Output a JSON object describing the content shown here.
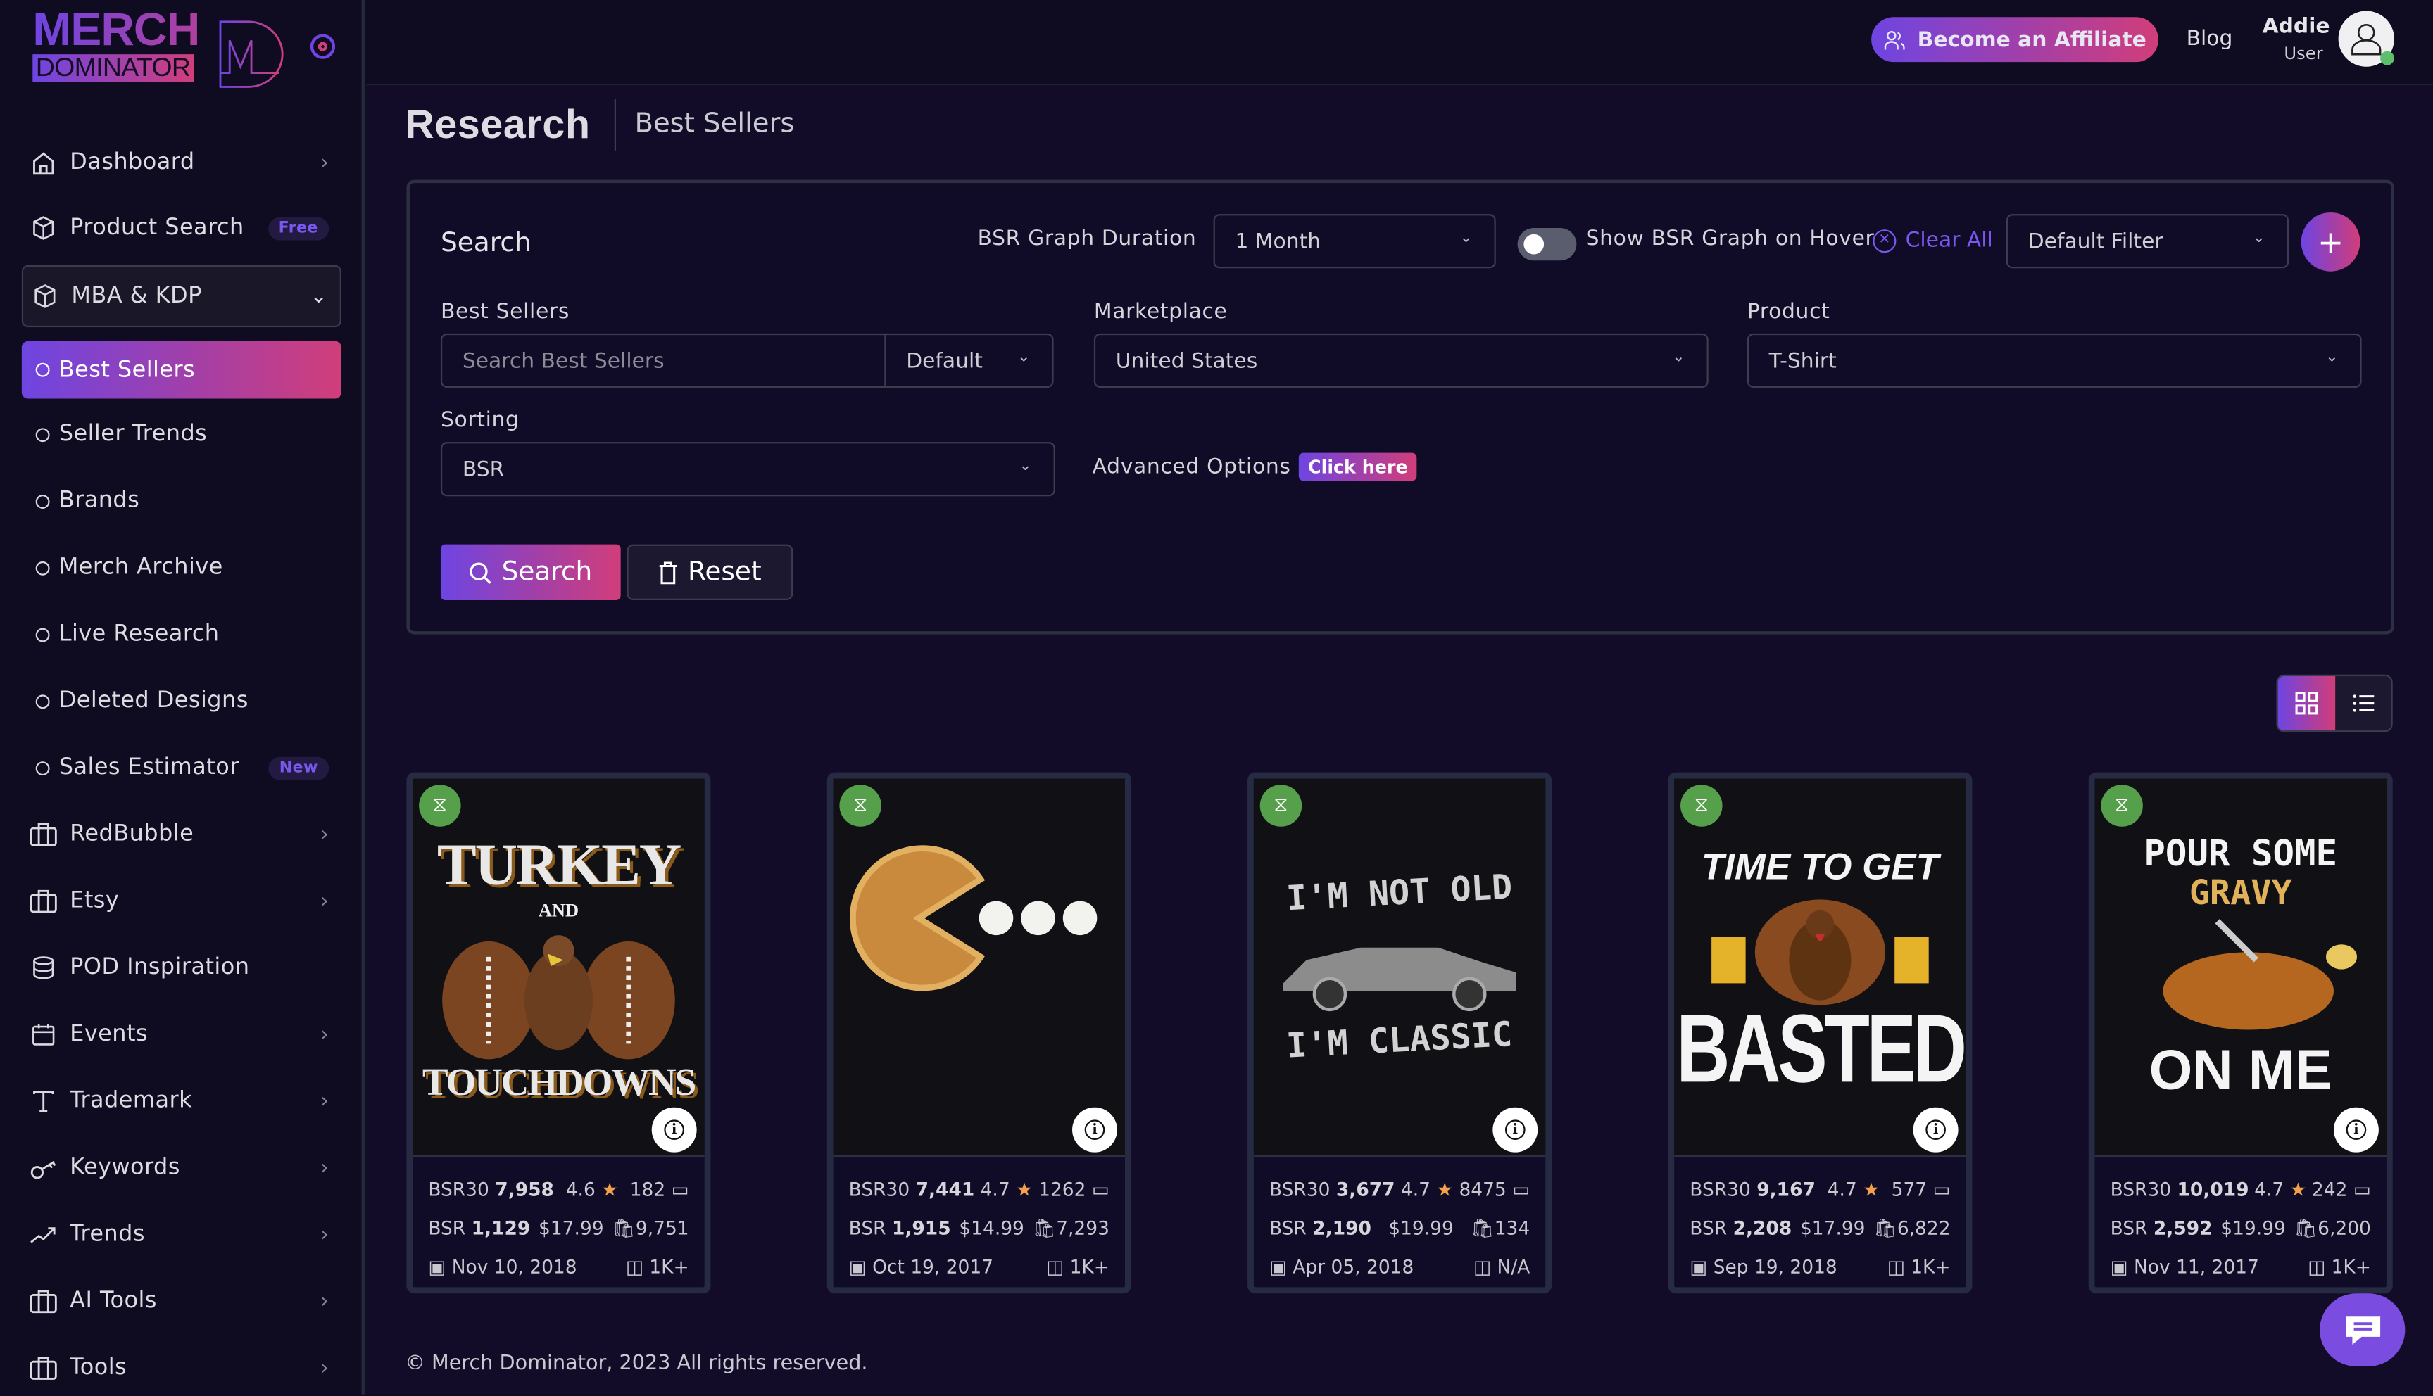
{
  "brand": {
    "line1": "MERCH",
    "line2": "DOMINATOR",
    "mark": "M"
  },
  "sidebar": {
    "items": [
      {
        "label": "Dashboard",
        "icon": "home-icon",
        "chevron": true
      },
      {
        "label": "Product Search",
        "icon": "box-icon",
        "badge": "Free"
      },
      {
        "label": "MBA & KDP",
        "icon": "box-icon",
        "expanded": true
      },
      {
        "label": "Best Sellers",
        "active": true
      },
      {
        "label": "Seller Trends"
      },
      {
        "label": "Brands"
      },
      {
        "label": "Merch Archive"
      },
      {
        "label": "Live Research"
      },
      {
        "label": "Deleted Designs"
      },
      {
        "label": "Sales Estimator",
        "badge": "New"
      },
      {
        "label": "RedBubble",
        "icon": "briefcase-icon",
        "chevron": true
      },
      {
        "label": "Etsy",
        "icon": "briefcase-icon",
        "chevron": true
      },
      {
        "label": "POD Inspiration",
        "icon": "database-icon"
      },
      {
        "label": "Events",
        "icon": "calendar-icon",
        "chevron": true
      },
      {
        "label": "Trademark",
        "icon": "text-icon",
        "chevron": true
      },
      {
        "label": "Keywords",
        "icon": "key-icon",
        "chevron": true
      },
      {
        "label": "Trends",
        "icon": "trending-up-icon",
        "chevron": true
      },
      {
        "label": "AI Tools",
        "icon": "briefcase-icon",
        "chevron": true
      },
      {
        "label": "Tools",
        "icon": "briefcase-icon",
        "chevron": true
      }
    ]
  },
  "header": {
    "affiliate_label": "Become an Affiliate",
    "blog_label": "Blog",
    "user_name": "Addie",
    "user_role": "User"
  },
  "page": {
    "title": "Research",
    "subtitle": "Best Sellers"
  },
  "search": {
    "title": "Search",
    "bsr_duration_label": "BSR Graph Duration",
    "bsr_duration_value": "1 Month",
    "show_bsr_label": "Show BSR Graph on Hover",
    "show_bsr_on": false,
    "clear_all_label": "Clear All",
    "filter_value": "Default Filter",
    "best_sellers_label": "Best Sellers",
    "best_sellers_placeholder": "Search Best Sellers",
    "best_sellers_mode": "Default",
    "marketplace_label": "Marketplace",
    "marketplace_value": "United States",
    "product_label": "Product",
    "product_value": "T-Shirt",
    "sorting_label": "Sorting",
    "sorting_value": "BSR",
    "advanced_label": "Advanced Options",
    "advanced_link": "Click here",
    "search_btn": "Search",
    "reset_btn": "Reset"
  },
  "view": {
    "active": "grid"
  },
  "products": [
    {
      "art_lines": [
        "TURKEY",
        "AND",
        "TOUCHDOWNS"
      ],
      "bsr30_label": "BSR30",
      "bsr30": "7,958",
      "rating": "4.6",
      "reviews": "182",
      "bsr_label": "BSR",
      "bsr": "1,129",
      "price": "$17.99",
      "sales": "9,751",
      "date": "Nov 10, 2018",
      "bought": "1K+"
    },
    {
      "art_lines": [
        "",
        "",
        ""
      ],
      "bsr30_label": "BSR30",
      "bsr30": "7,441",
      "rating": "4.7",
      "reviews": "1262",
      "bsr_label": "BSR",
      "bsr": "1,915",
      "price": "$14.99",
      "sales": "7,293",
      "date": "Oct 19, 2017",
      "bought": "1K+"
    },
    {
      "art_lines": [
        "I'M NOT OLD",
        "",
        "I'M CLASSIC"
      ],
      "bsr30_label": "BSR30",
      "bsr30": "3,677",
      "rating": "4.7",
      "reviews": "8475",
      "bsr_label": "BSR",
      "bsr": "2,190",
      "price": "$19.99",
      "sales": "134",
      "date": "Apr 05, 2018",
      "bought": "N/A"
    },
    {
      "art_lines": [
        "TIME TO GET",
        "",
        "BASTED"
      ],
      "bsr30_label": "BSR30",
      "bsr30": "9,167",
      "rating": "4.7",
      "reviews": "577",
      "bsr_label": "BSR",
      "bsr": "2,208",
      "price": "$17.99",
      "sales": "6,822",
      "date": "Sep 19, 2018",
      "bought": "1K+"
    },
    {
      "art_lines": [
        "POUR SOME",
        "GRAVY",
        "ON ME"
      ],
      "bsr30_label": "BSR30",
      "bsr30": "10,019",
      "rating": "4.7",
      "reviews": "242",
      "bsr_label": "BSR",
      "bsr": "2,592",
      "price": "$19.99",
      "sales": "6,200",
      "date": "Nov 11, 2017",
      "bought": "1K+"
    }
  ],
  "footer": {
    "copyright": "© Merch Dominator, 2023 All rights reserved."
  },
  "colors": {
    "accent_start": "#6e45e2",
    "accent_end": "#d13e7a",
    "link": "#7b57f0",
    "star": "#f3a04b",
    "badge_green": "#56a04c",
    "background": "#0f0b20"
  }
}
